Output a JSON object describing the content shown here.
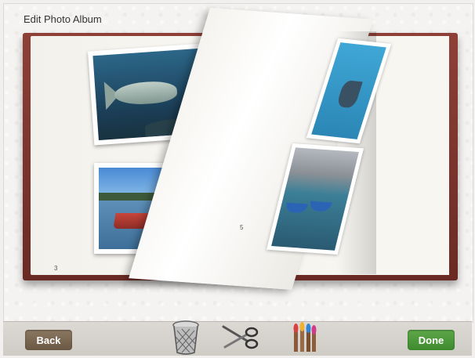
{
  "screen": {
    "title": "Edit Photo Album"
  },
  "album": {
    "left_page_number": "3",
    "turning_page_number": "5"
  },
  "toolbar": {
    "back_label": "Back",
    "done_label": "Done",
    "tools": [
      "trash-icon",
      "scissors-icon",
      "paint-brushes-icon"
    ]
  },
  "colors": {
    "book_cover": "#7a332c",
    "back_button": "#7a6753",
    "done_button": "#4a9a39"
  }
}
